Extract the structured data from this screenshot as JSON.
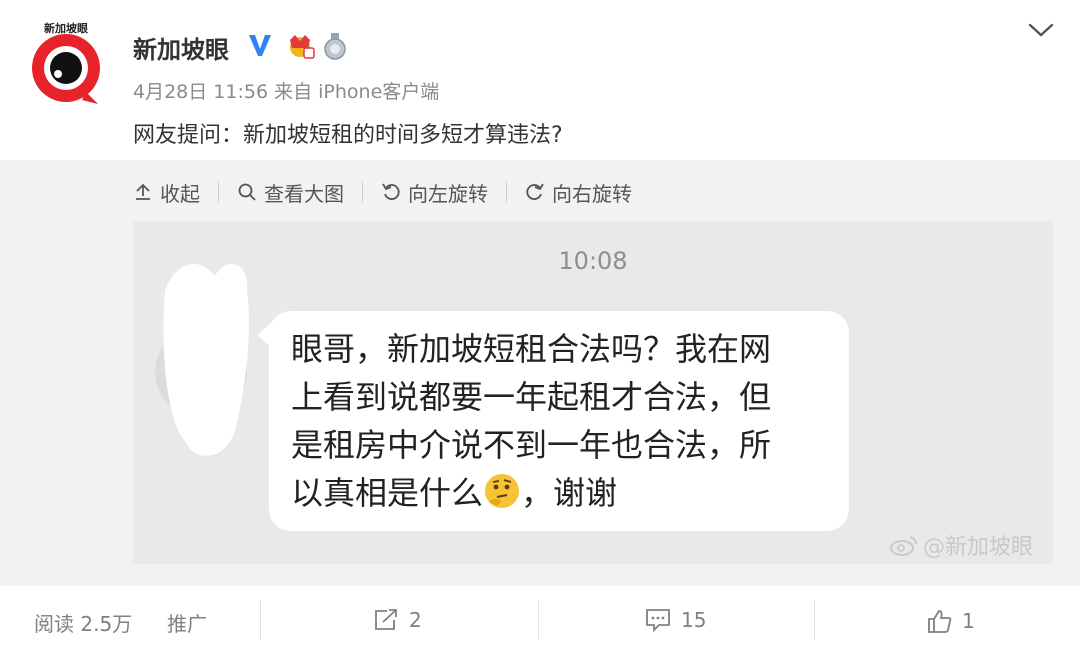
{
  "post": {
    "author": "新加坡眼",
    "avatar_label": "新加坡眼",
    "meta": "4月28日 11:56 来自 iPhone客户端",
    "text": "网友提问：新加坡短租的时间多短才算违法?",
    "icons": [
      "verified-v-icon",
      "crown-badge-icon",
      "medal-badge-icon",
      "chevron-down-icon"
    ]
  },
  "toolbar": {
    "collapse": "收起",
    "view_large": "查看大图",
    "rotate_left": "向左旋转",
    "rotate_right": "向右旋转"
  },
  "chat": {
    "time": "10:08",
    "message": "眼哥，新加坡短租合法吗？我在网\n上看到说都要一年起租才合法，但\n是租房中介说不到一年也合法，所\n以真相是什么",
    "message_suffix": "，谢谢",
    "watermark": "@新加坡眼"
  },
  "footer": {
    "reads": "阅读 2.5万",
    "promote": "推广",
    "reposts": "2",
    "comments": "15",
    "likes": "1"
  },
  "colors": {
    "verified_blue": "#2f82f2",
    "avatar_red": "#e6222a",
    "panel_bg": "#f2f2f2"
  }
}
